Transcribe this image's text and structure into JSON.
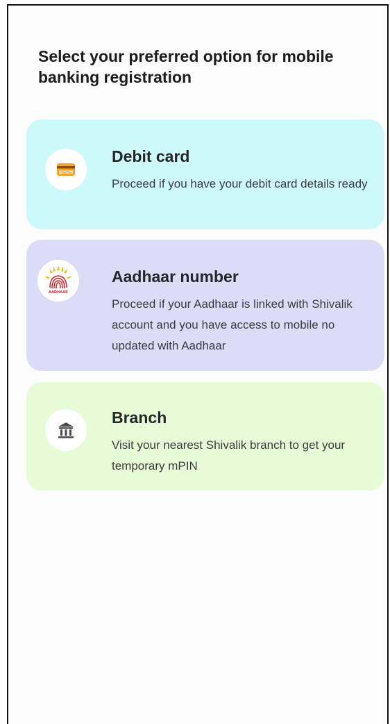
{
  "page": {
    "title": "Select your preferred option for mobile banking registration"
  },
  "options": [
    {
      "id": "debit-card",
      "icon": "credit-card-icon",
      "title": "Debit card",
      "description": "Proceed if you have your debit card details ready",
      "background_color": "#cdf9fa"
    },
    {
      "id": "aadhaar",
      "icon": "aadhaar-logo-icon",
      "title": "Aadhaar number",
      "description": "Proceed if your Aadhaar is linked with Shivalik account and you have access to mobile no updated with Aadhaar",
      "background_color": "#dcdcf8",
      "logo_text": "AADHAAR"
    },
    {
      "id": "branch",
      "icon": "bank-building-icon",
      "title": "Branch",
      "description": "Visit your nearest Shivalik branch to get your temporary mPIN",
      "background_color": "#e5fcd6"
    }
  ],
  "colors": {
    "card_icon_orange": "#f3a530",
    "aadhaar_red": "#d8262f",
    "aadhaar_yellow": "#f6b91b",
    "bank_icon_dark": "#4a4a4a"
  }
}
